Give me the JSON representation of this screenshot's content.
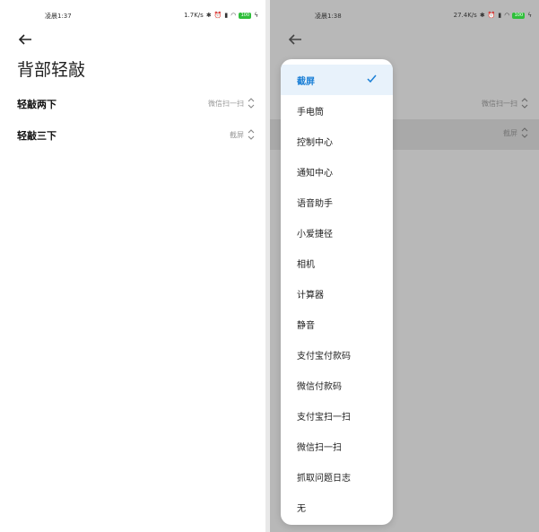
{
  "left_screen": {
    "status_bar": {
      "time": "凌晨1:37",
      "speed": "1.7K/s",
      "battery": "100"
    },
    "page_title": "背部轻敲",
    "rows": [
      {
        "label": "轻敲两下",
        "value": "微信扫一扫"
      },
      {
        "label": "轻敲三下",
        "value": "截屏"
      }
    ]
  },
  "right_screen": {
    "status_bar": {
      "time": "凌晨1:38",
      "speed": "27.4K/s",
      "battery": "100"
    },
    "rows": [
      {
        "label": "",
        "value": "微信扫一扫"
      },
      {
        "label": "",
        "value": "截屏"
      }
    ],
    "dropdown": {
      "selected": "截屏",
      "options": [
        "截屏",
        "手电筒",
        "控制中心",
        "通知中心",
        "语音助手",
        "小爱捷径",
        "相机",
        "计算器",
        "静音",
        "支付宝付款码",
        "微信付款码",
        "支付宝扫一扫",
        "微信扫一扫",
        "抓取问题日志",
        "无"
      ]
    }
  },
  "colors": {
    "accent": "#1a7fd6",
    "battery_green": "#2fbf3a",
    "overlay": "#b8b8b8"
  }
}
